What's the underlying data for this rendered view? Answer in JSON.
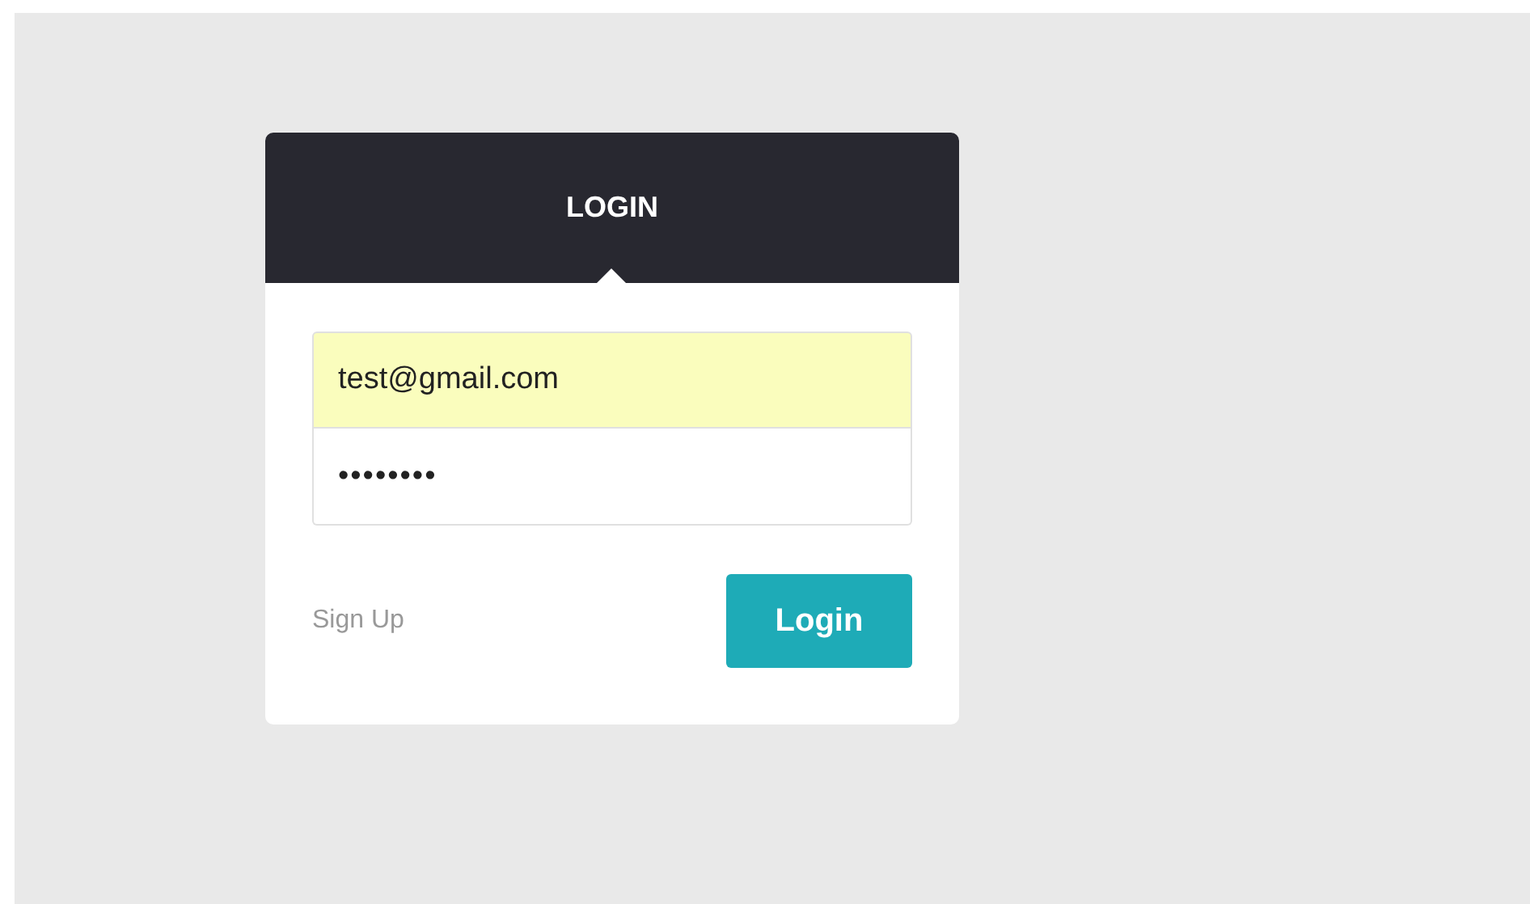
{
  "header": {
    "title": "LOGIN"
  },
  "email": {
    "value": "test@gmail.com",
    "autofilled": true
  },
  "password": {
    "value": "••••••••"
  },
  "sign_up": "Sign Up",
  "login_button": "Login"
}
